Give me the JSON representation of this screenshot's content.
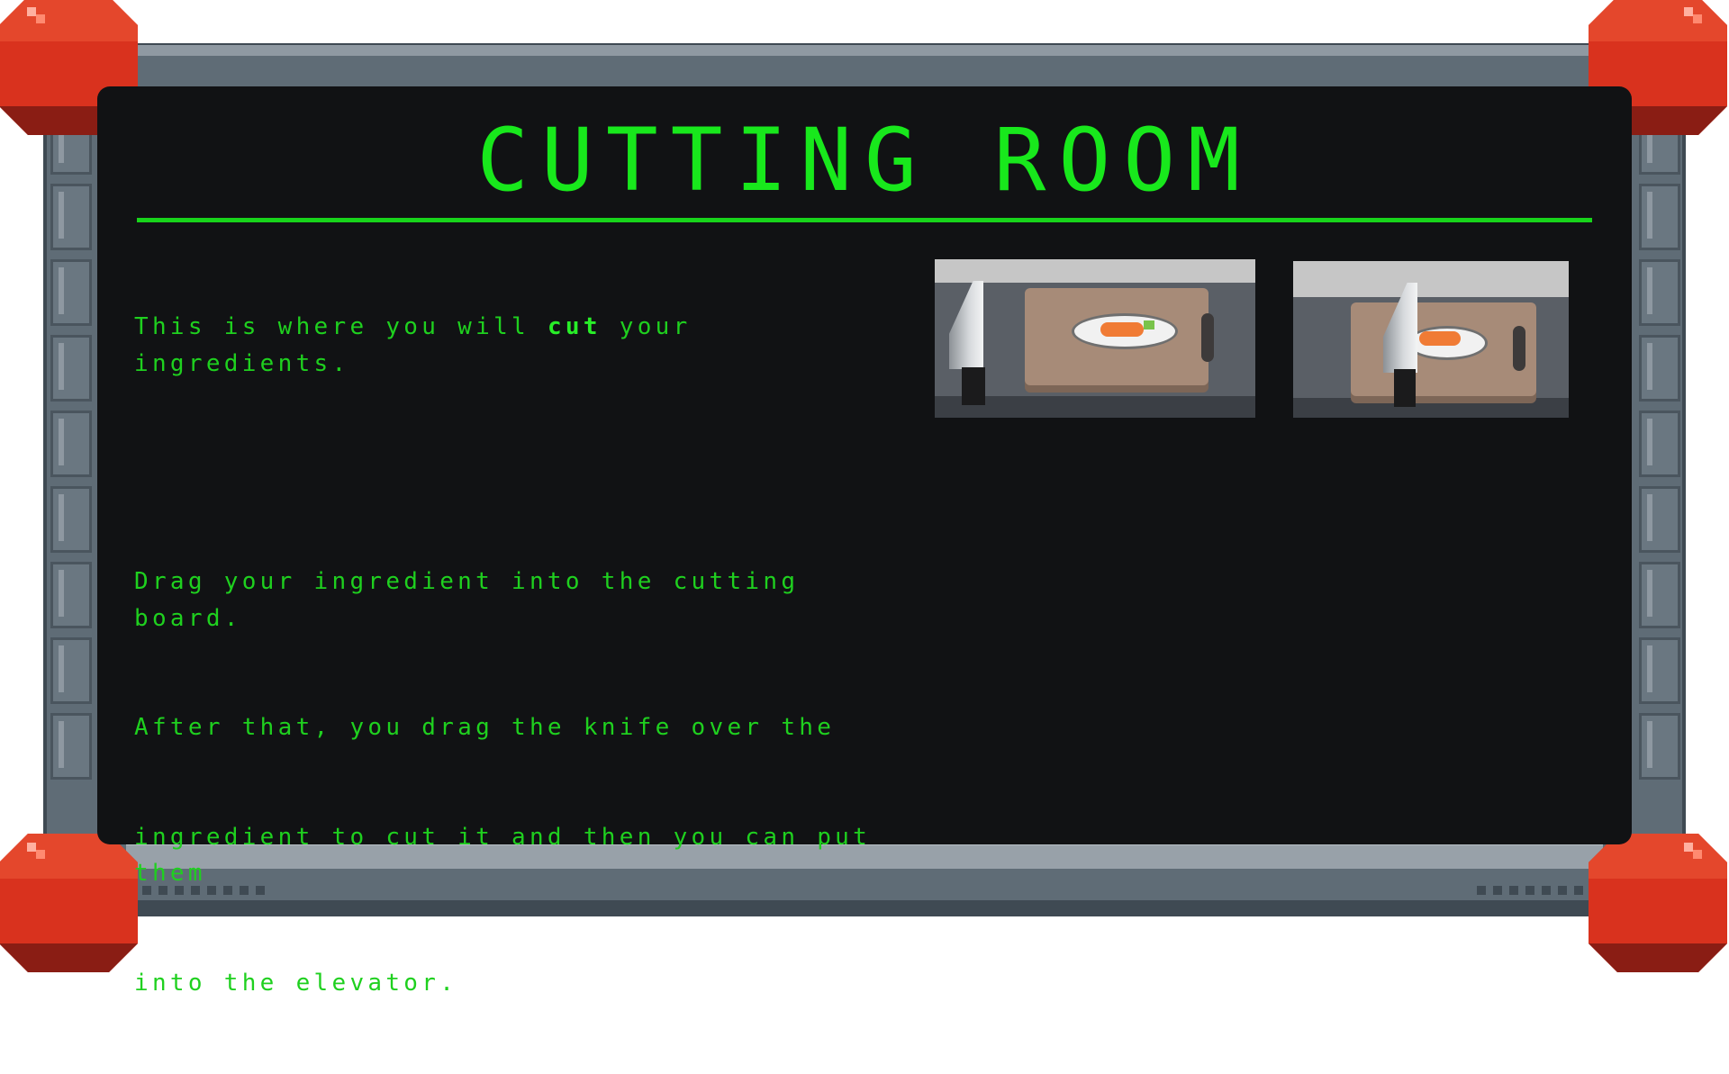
{
  "screen": {
    "title": "CUTTING ROOM",
    "lines": {
      "line1_before": "This is where you will ",
      "line1_bold": "cut",
      "line1_after": " your ingredients.",
      "line2": "Drag your ingredient into the cutting board.",
      "line3": "After that, you drag the knife over the",
      "line4": "ingredient to cut it and then you can put them",
      "line5": "into the elevator."
    }
  },
  "illustrations": [
    {
      "id": "uncut",
      "icons": [
        "knife-icon",
        "cutting-board-icon",
        "plate-icon",
        "carrot-icon"
      ]
    },
    {
      "id": "cutting",
      "icons": [
        "knife-icon",
        "cutting-board-icon",
        "plate-icon",
        "carrot-pieces-icon"
      ]
    }
  ],
  "colors": {
    "terminal_green": "#18e81c",
    "screen_bg": "#111214",
    "frame": "#5f6c76",
    "corner_knob": "#d9321e"
  }
}
